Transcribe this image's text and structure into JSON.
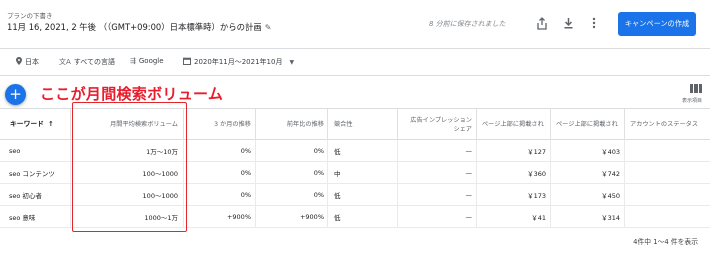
{
  "header": {
    "draft_label": "プランの下書き",
    "plan_title": "11月 16, 2021, 2 午後 （（GMT+09:00）日本標準時）からの計画",
    "saved_status": "8 分前に保存されました",
    "create_campaign_label": "キャンペーンの作成"
  },
  "filters": {
    "location": "日本",
    "language": "すべての言語",
    "network": "Google",
    "date_range": "2020年11月～2021年10月"
  },
  "annotation": {
    "text": "ここが月間検索ボリューム",
    "color": "#ea1c2c"
  },
  "toolbar": {
    "columns_label": "表示項目"
  },
  "table": {
    "headers": {
      "keyword": "キーワード",
      "sort_arrow": "↑",
      "avg_monthly_searches": "月間平均検索ボリューム",
      "three_month_change": "3 か月の推移",
      "yoy_change": "前年比の推移",
      "competition": "競合性",
      "ad_impression_share_line1": "広告インプレッション",
      "ad_impression_share_line2": "シェア",
      "top_bid_low": "ページ上部に掲載され",
      "top_bid_high": "ページ上部に掲載され",
      "account_status": "アカウントのステータス"
    },
    "rows": [
      {
        "keyword": "seo",
        "volume": "1万～10万",
        "three_month": "0%",
        "yoy": "0%",
        "competition": "低",
        "impression_share": "—",
        "bid_low": "￥127",
        "bid_high": "￥403",
        "status": ""
      },
      {
        "keyword": "seo コンテンツ",
        "volume": "100～1000",
        "three_month": "0%",
        "yoy": "0%",
        "competition": "中",
        "impression_share": "—",
        "bid_low": "￥360",
        "bid_high": "￥742",
        "status": ""
      },
      {
        "keyword": "seo 初心者",
        "volume": "100～1000",
        "three_month": "0%",
        "yoy": "0%",
        "competition": "低",
        "impression_share": "—",
        "bid_low": "￥173",
        "bid_high": "￥450",
        "status": ""
      },
      {
        "keyword": "seo 意味",
        "volume": "1000～1万",
        "three_month": "+900%",
        "yoy": "+900%",
        "competition": "低",
        "impression_share": "—",
        "bid_low": "￥41",
        "bid_high": "￥314",
        "status": ""
      }
    ]
  },
  "footer": {
    "pagination": "4件中 1～4 件を表示"
  },
  "icons": {
    "pencil": "pencil-icon",
    "share": "share-icon",
    "download": "download-icon",
    "more": "more-vert-icon",
    "location": "location-pin-icon",
    "language": "translate-icon",
    "network": "search-network-icon",
    "calendar": "calendar-icon",
    "add": "add-icon",
    "columns": "columns-icon"
  },
  "colors": {
    "primary": "#1a73e8",
    "annotation": "#ea1c2c"
  }
}
